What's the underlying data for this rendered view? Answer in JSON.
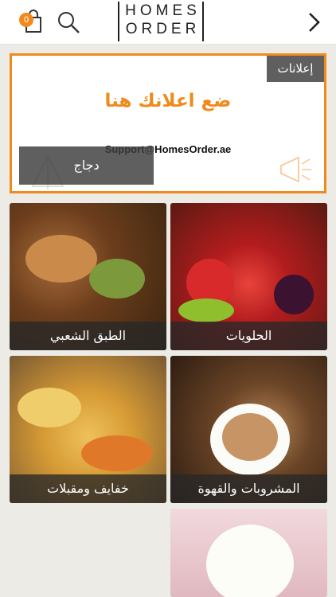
{
  "header": {
    "logo_line1": "HOMES",
    "logo_line2": "ORDER",
    "cart_count": "0",
    "icons": [
      "shopping-bag-icon",
      "search-icon",
      "chevron-right-icon"
    ]
  },
  "ad": {
    "tag": "إعلانات",
    "title": "ضع اعلانك هنا",
    "email": "Support@HomesOrder.ae",
    "overlay_label": "دجاج"
  },
  "categories": [
    {
      "label": "الطبق الشعبي"
    },
    {
      "label": "الحلويات"
    },
    {
      "label": "خفايف ومقبلات"
    },
    {
      "label": "المشروبات والقهوة"
    },
    {
      "label": ""
    }
  ],
  "colors": {
    "accent": "#f08a1c",
    "label_bg": "#3a3a3a",
    "page_bg": "#ecebe6"
  }
}
